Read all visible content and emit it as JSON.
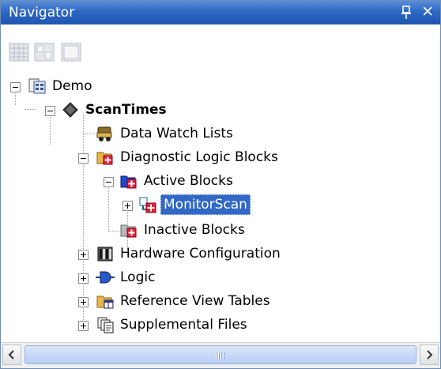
{
  "panel": {
    "title": "Navigator"
  },
  "toolbar": {
    "buttons": [
      "grid-view-icon",
      "split-view-icon",
      "blank-view-icon"
    ]
  },
  "tree": {
    "nodes": [
      {
        "label": "Demo",
        "icon": "project-icon",
        "expander": "minus"
      },
      {
        "label": "ScanTimes",
        "icon": "target-diamond-icon",
        "expander": "minus",
        "bold": true
      },
      {
        "label": "Data Watch Lists",
        "icon": "watch-list-icon",
        "expander": "none"
      },
      {
        "label": "Diagnostic Logic Blocks",
        "icon": "diagnostic-folder-icon",
        "expander": "minus"
      },
      {
        "label": "Active Blocks",
        "icon": "active-folder-icon",
        "expander": "minus"
      },
      {
        "label": "MonitorScan",
        "icon": "logic-block-icon",
        "expander": "plus",
        "selected": true
      },
      {
        "label": "Inactive Blocks",
        "icon": "inactive-folder-icon",
        "expander": "none"
      },
      {
        "label": "Hardware Configuration",
        "icon": "hardware-icon",
        "expander": "plus"
      },
      {
        "label": "Logic",
        "icon": "logic-icon",
        "expander": "plus"
      },
      {
        "label": "Reference View Tables",
        "icon": "reference-folder-icon",
        "expander": "plus"
      },
      {
        "label": "Supplemental Files",
        "icon": "files-icon",
        "expander": "plus"
      }
    ]
  },
  "colors": {
    "titlebar": "#2e68c3",
    "selection": "#3168c6"
  }
}
